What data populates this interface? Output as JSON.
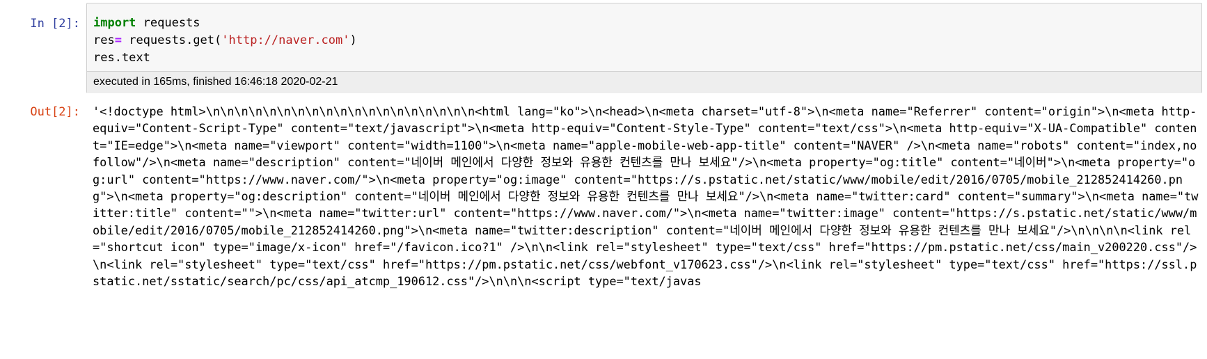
{
  "input_cell": {
    "prompt": "In [2]:",
    "code": {
      "line1_keyword": "import",
      "line1_rest": " requests",
      "line2_var": "res",
      "line2_op": "=",
      "line2_call": " requests.get(",
      "line2_str": "'http://naver.com'",
      "line2_close": ")",
      "line3": "res.text"
    },
    "execution_info": "executed in 165ms, finished 16:46:18 2020-02-21"
  },
  "output_cell": {
    "prompt": "Out[2]:",
    "text": "'<!doctype html>\\n\\n\\n\\n\\n\\n\\n\\n\\n\\n\\n\\n\\n\\n\\n\\n\\n\\n\\n<html lang=\"ko\">\\n<head>\\n<meta charset=\"utf-8\">\\n<meta name=\"Referrer\" content=\"origin\">\\n<meta http-equiv=\"Content-Script-Type\" content=\"text/javascript\">\\n<meta http-equiv=\"Content-Style-Type\" content=\"text/css\">\\n<meta http-equiv=\"X-UA-Compatible\" content=\"IE=edge\">\\n<meta name=\"viewport\" content=\"width=1100\">\\n<meta name=\"apple-mobile-web-app-title\" content=\"NAVER\" />\\n<meta name=\"robots\" content=\"index,nofollow\"/>\\n<meta name=\"description\" content=\"네이버 메인에서 다양한 정보와 유용한 컨텐츠를 만나 보세요\"/>\\n<meta property=\"og:title\" content=\"네이버\">\\n<meta property=\"og:url\" content=\"https://www.naver.com/\">\\n<meta property=\"og:image\" content=\"https://s.pstatic.net/static/www/mobile/edit/2016/0705/mobile_212852414260.png\">\\n<meta property=\"og:description\" content=\"네이버 메인에서 다양한 정보와 유용한 컨텐츠를 만나 보세요\"/>\\n<meta name=\"twitter:card\" content=\"summary\">\\n<meta name=\"twitter:title\" content=\"\">\\n<meta name=\"twitter:url\" content=\"https://www.naver.com/\">\\n<meta name=\"twitter:image\" content=\"https://s.pstatic.net/static/www/mobile/edit/2016/0705/mobile_212852414260.png\">\\n<meta name=\"twitter:description\" content=\"네이버 메인에서 다양한 정보와 유용한 컨텐츠를 만나 보세요\"/>\\n\\n\\n\\n<link rel=\"shortcut icon\" type=\"image/x-icon\" href=\"/favicon.ico?1\" />\\n\\n<link rel=\"stylesheet\" type=\"text/css\" href=\"https://pm.pstatic.net/css/main_v200220.css\"/> \\n<link rel=\"stylesheet\" type=\"text/css\" href=\"https://pm.pstatic.net/css/webfont_v170623.css\"/>\\n<link rel=\"stylesheet\" type=\"text/css\" href=\"https://ssl.pstatic.net/sstatic/search/pc/css/api_atcmp_190612.css\"/>\\n\\n\\n<script type=\"text/javas"
  }
}
